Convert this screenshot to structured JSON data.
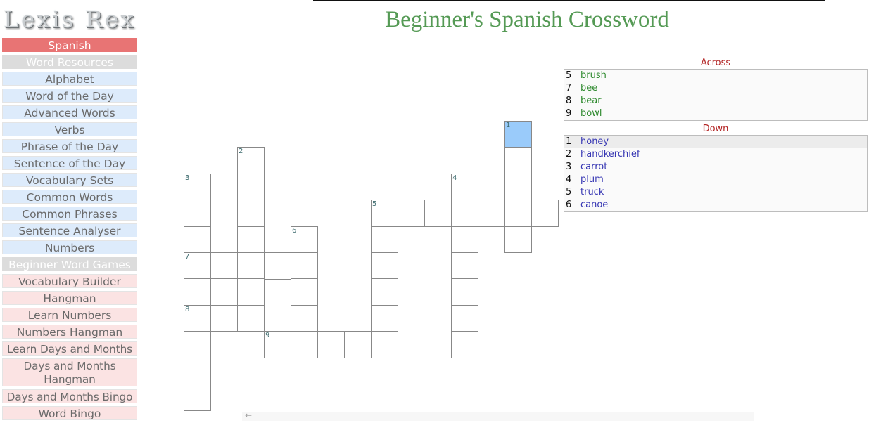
{
  "logo": "Lexis Rex",
  "sidebar": {
    "language": "Spanish",
    "sections": [
      {
        "heading": "Word Resources",
        "style": "blue",
        "items": [
          "Alphabet",
          "Word of the Day",
          "Advanced Words",
          "Verbs",
          "Phrase of the Day",
          "Sentence of the Day",
          "Vocabulary Sets",
          "Common Words",
          "Common Phrases",
          "Sentence Analyser",
          "Numbers"
        ]
      },
      {
        "heading": "Beginner Word Games",
        "style": "pink",
        "items": [
          "Vocabulary Builder",
          "Hangman",
          "Learn Numbers",
          "Numbers Hangman",
          "Learn Days and Months",
          "Days and Months Hangman",
          "Days and Months Bingo",
          "Word Bingo"
        ]
      }
    ]
  },
  "page": {
    "title": "Beginner's Spanish Crossword"
  },
  "colors": {
    "selected_cell": "#9acbfa",
    "across": "#2f8a2f",
    "down": "#3636b3",
    "clue_heading": "#b22222",
    "title": "#559a55"
  },
  "crossword": {
    "selected_clue": "1 down",
    "cells": [
      {
        "c": 12,
        "r": 0,
        "n": "1",
        "sel": true
      },
      {
        "c": 12,
        "r": 1
      },
      {
        "c": 12,
        "r": 2
      },
      {
        "c": 12,
        "r": 4
      },
      {
        "c": 2,
        "r": 1,
        "n": "2"
      },
      {
        "c": 2,
        "r": 2
      },
      {
        "c": 2,
        "r": 3
      },
      {
        "c": 2,
        "r": 4
      },
      {
        "c": 2,
        "r": 5
      },
      {
        "c": 2,
        "r": 6
      },
      {
        "c": 2,
        "r": 7
      },
      {
        "c": 0,
        "r": 2,
        "n": "3"
      },
      {
        "c": 0,
        "r": 3
      },
      {
        "c": 0,
        "r": 4
      },
      {
        "c": 0,
        "r": 5,
        "n": "7"
      },
      {
        "c": 0,
        "r": 6
      },
      {
        "c": 0,
        "r": 7,
        "n": "8"
      },
      {
        "c": 0,
        "r": 8
      },
      {
        "c": 0,
        "r": 9
      },
      {
        "c": 0,
        "r": 10
      },
      {
        "c": 10,
        "r": 2,
        "n": "4"
      },
      {
        "c": 10,
        "r": 4
      },
      {
        "c": 10,
        "r": 5
      },
      {
        "c": 10,
        "r": 6
      },
      {
        "c": 10,
        "r": 7
      },
      {
        "c": 10,
        "r": 8
      },
      {
        "c": 7,
        "r": 3,
        "n": "5"
      },
      {
        "c": 8,
        "r": 3
      },
      {
        "c": 9,
        "r": 3
      },
      {
        "c": 10,
        "r": 3
      },
      {
        "c": 11,
        "r": 3
      },
      {
        "c": 12,
        "r": 3
      },
      {
        "c": 13,
        "r": 3
      },
      {
        "c": 7,
        "r": 4
      },
      {
        "c": 7,
        "r": 5
      },
      {
        "c": 7,
        "r": 6
      },
      {
        "c": 7,
        "r": 7
      },
      {
        "c": 7,
        "r": 8
      },
      {
        "c": 4,
        "r": 4,
        "n": "6"
      },
      {
        "c": 4,
        "r": 5
      },
      {
        "c": 4,
        "r": 6
      },
      {
        "c": 4,
        "r": 7
      },
      {
        "c": 4,
        "r": 8
      },
      {
        "c": 1,
        "r": 5
      },
      {
        "c": 3,
        "r": 5
      },
      {
        "c": 1,
        "r": 6
      },
      {
        "c": 1,
        "r": 7
      },
      {
        "c": 3,
        "r": 8,
        "n": "9"
      },
      {
        "c": 5,
        "r": 8
      },
      {
        "c": 6,
        "r": 8
      }
    ]
  },
  "clues": {
    "across_label": "Across",
    "down_label": "Down",
    "across": [
      {
        "num": "5",
        "word": "brush"
      },
      {
        "num": "7",
        "word": "bee"
      },
      {
        "num": "8",
        "word": "bear"
      },
      {
        "num": "9",
        "word": "bowl"
      }
    ],
    "down": [
      {
        "num": "1",
        "word": "honey",
        "active": true
      },
      {
        "num": "2",
        "word": "handkerchief"
      },
      {
        "num": "3",
        "word": "carrot"
      },
      {
        "num": "4",
        "word": "plum"
      },
      {
        "num": "5",
        "word": "truck"
      },
      {
        "num": "6",
        "word": "canoe"
      }
    ]
  },
  "scrollbar": {
    "icon": "arrow-left-icon"
  }
}
